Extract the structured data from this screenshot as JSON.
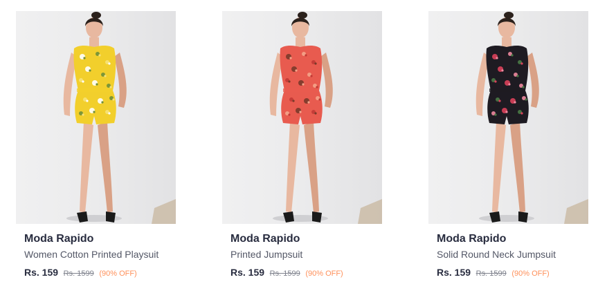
{
  "products": [
    {
      "brand": "Moda Rapido",
      "name": "Women Cotton Printed Playsuit",
      "price": "Rs. 159",
      "mrp": "Rs. 1599",
      "discount": "(90% OFF)",
      "dress_color": "#f2cf2c",
      "print_colors": [
        "#ffffff",
        "#6f8f3a",
        "#f6e27a"
      ]
    },
    {
      "brand": "Moda Rapido",
      "name": "Printed Jumpsuit",
      "price": "Rs. 159",
      "mrp": "Rs. 1599",
      "discount": "(90% OFF)",
      "dress_color": "#e85b4f",
      "print_colors": [
        "#7a3a2a",
        "#f4a48a",
        "#c23a35"
      ]
    },
    {
      "brand": "Moda Rapido",
      "name": "Solid Round Neck Jumpsuit",
      "price": "Rs. 159",
      "mrp": "Rs. 1599",
      "discount": "(90% OFF)",
      "dress_color": "#1e1b22",
      "print_colors": [
        "#d9415a",
        "#f08aa0",
        "#4a7a46"
      ]
    }
  ],
  "colors": {
    "price_text": "#282c3f",
    "mrp_text": "#7e818c",
    "discount_text": "#ff905a",
    "photo_bg": "#e9e9ea"
  }
}
